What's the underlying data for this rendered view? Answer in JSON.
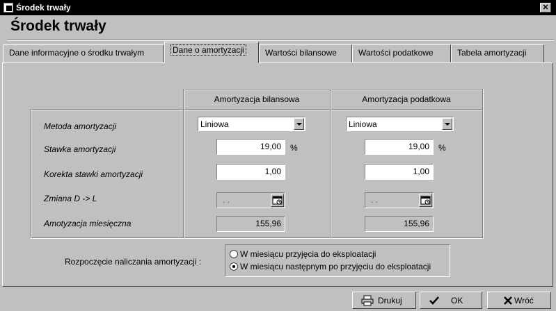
{
  "window": {
    "title": "Środek trwały"
  },
  "header": {
    "title": "Środek trwały"
  },
  "tabs": [
    {
      "label": "Dane informacyjne o środku trwałym"
    },
    {
      "label": "Dane o amortyzacji"
    },
    {
      "label": "Wartości bilansowe"
    },
    {
      "label": "Wartości podatkowe"
    },
    {
      "label": "Tabela amortyzacji"
    }
  ],
  "grid": {
    "columns": [
      "Amortyzacja bilansowa",
      "Amortyzacja podatkowa"
    ],
    "rows": {
      "metoda": "Metoda amortyzacji",
      "stawka": "Stawka amortyzacji",
      "korekta": "Korekta stawki amortyzacji",
      "zmiana": "Zmiana D -> L",
      "miesieczna": "Amotyzacja miesięczna"
    },
    "bilansowa": {
      "metoda": "Liniowa",
      "stawka": "19,00",
      "stawka_unit": "%",
      "korekta": "1,00",
      "zmiana": ". .",
      "miesieczna": "155,96"
    },
    "podatkowa": {
      "metoda": "Liniowa",
      "stawka": "19,00",
      "stawka_unit": "%",
      "korekta": "1,00",
      "zmiana": ". .",
      "miesieczna": "155,96"
    }
  },
  "start": {
    "label": "Rozpoczęcie naliczania amortyzacji :",
    "options": [
      {
        "label": "W miesiącu przyjęcia do eksploatacji",
        "selected": false
      },
      {
        "label": "W miesiącu następnym po przyjęciu do eksploatacji",
        "selected": true
      }
    ]
  },
  "buttons": {
    "print": "Drukuj",
    "ok": "OK",
    "back": "Wróć"
  },
  "icons": {
    "calendar": "calendar-icon",
    "printer": "printer-icon",
    "check": "check-icon",
    "close": "x-icon"
  }
}
